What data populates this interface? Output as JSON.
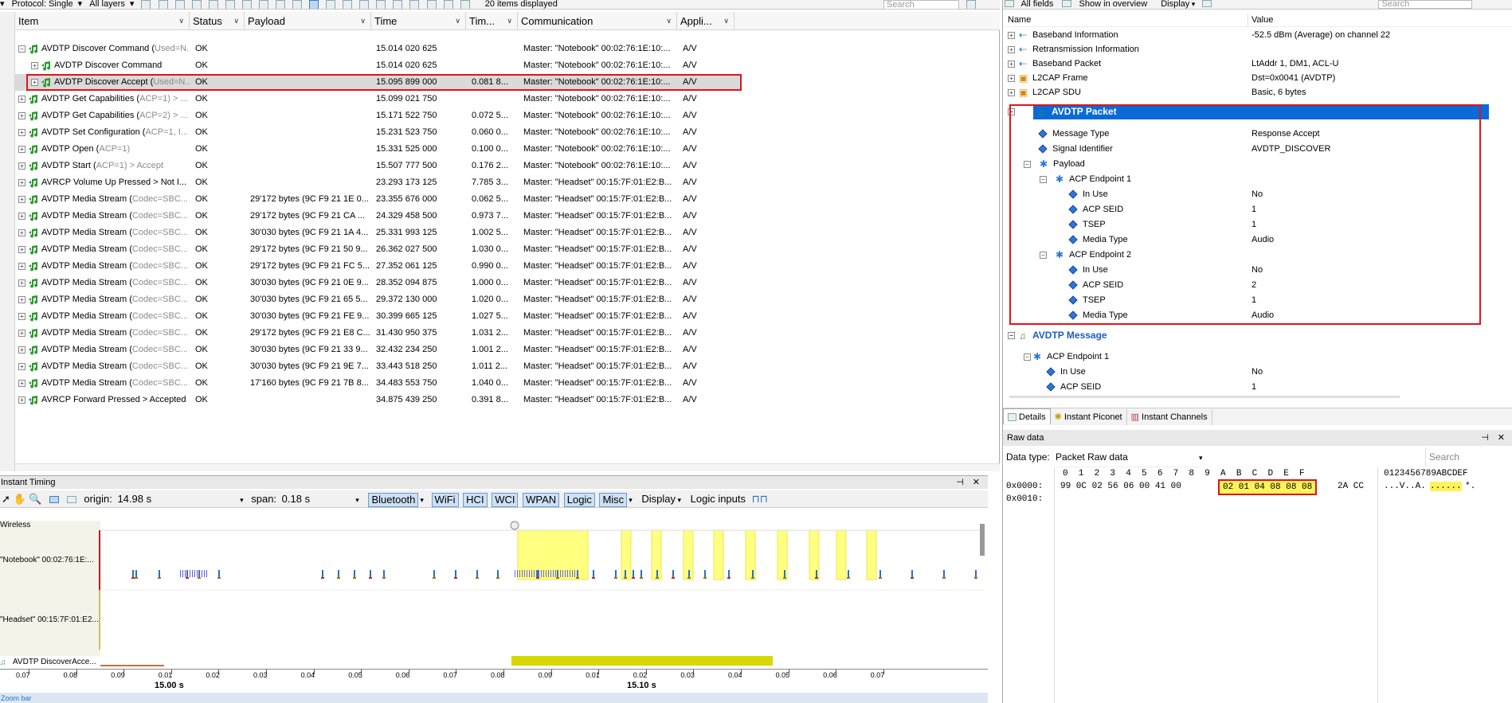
{
  "toolbar": {
    "protocol": "Protocol: Single",
    "layers": "All layers",
    "items_displayed": "20 items displayed",
    "search_placeholder": "Search"
  },
  "columns": [
    "Item",
    "Status",
    "Payload",
    "Time",
    "Tim...",
    "Communication",
    "Appli..."
  ],
  "rows": [
    {
      "exp": "−",
      "indent": 0,
      "item": "AVDTP Discover Command",
      "extra": "Used=N...",
      "status": "OK",
      "payload": "",
      "time": "15.014 020 625",
      "delta": "",
      "comm": "Master: \"Notebook\" 00:02:76:1E:10:...",
      "app": "A/V"
    },
    {
      "exp": "+",
      "indent": 1,
      "item": "AVDTP Discover Command",
      "extra": "",
      "status": "OK",
      "payload": "",
      "time": "15.014 020 625",
      "delta": "",
      "comm": "Master: \"Notebook\" 00:02:76:1E:10:...",
      "app": "A/V"
    },
    {
      "exp": "+",
      "indent": 1,
      "item": "AVDTP Discover Accept",
      "extra": "Used=N...",
      "status": "OK",
      "payload": "",
      "time": "15.095 899 000",
      "delta": "0.081 8...",
      "comm": "Master: \"Notebook\" 00:02:76:1E:10:...",
      "app": "A/V"
    },
    {
      "exp": "+",
      "indent": 0,
      "item": "AVDTP Get Capabilities",
      "extra": "ACP=1) > ...",
      "status": "OK",
      "payload": "",
      "time": "15.099 021 750",
      "delta": "",
      "comm": "Master: \"Notebook\" 00:02:76:1E:10:...",
      "app": "A/V"
    },
    {
      "exp": "+",
      "indent": 0,
      "item": "AVDTP Get Capabilities",
      "extra": "ACP=2) > ...",
      "status": "OK",
      "payload": "",
      "time": "15.171 522 750",
      "delta": "0.072 5...",
      "comm": "Master: \"Notebook\" 00:02:76:1E:10:...",
      "app": "A/V"
    },
    {
      "exp": "+",
      "indent": 0,
      "item": "AVDTP Set Configuration",
      "extra": "ACP=1, I...",
      "status": "OK",
      "payload": "",
      "time": "15.231 523 750",
      "delta": "0.060 0...",
      "comm": "Master: \"Notebook\" 00:02:76:1E:10:...",
      "app": "A/V"
    },
    {
      "exp": "+",
      "indent": 0,
      "item": "AVDTP Open",
      "extra": "ACP=1)",
      "status": "OK",
      "payload": "",
      "time": "15.331 525 000",
      "delta": "0.100 0...",
      "comm": "Master: \"Notebook\" 00:02:76:1E:10:...",
      "app": "A/V"
    },
    {
      "exp": "+",
      "indent": 0,
      "item": "AVDTP Start",
      "extra": "ACP=1) > Accept",
      "status": "OK",
      "payload": "",
      "time": "15.507 777 500",
      "delta": "0.176 2...",
      "comm": "Master: \"Notebook\" 00:02:76:1E:10:...",
      "app": "A/V"
    },
    {
      "exp": "+",
      "indent": 0,
      "item": "AVRCP Volume Up Pressed > Not I...",
      "extra": "",
      "status": "OK",
      "payload": "",
      "time": "23.293 173 125",
      "delta": "7.785 3...",
      "comm": "Master: \"Headset\" 00:15:7F:01:E2:B...",
      "app": "A/V"
    },
    {
      "exp": "+",
      "indent": 0,
      "item": "AVDTP Media Stream",
      "extra": "Codec=SBC...",
      "status": "OK",
      "payload": "29'172 bytes (9C F9 21 1E 0...",
      "time": "23.355 676 000",
      "delta": "0.062 5...",
      "comm": "Master: \"Headset\" 00:15:7F:01:E2:B...",
      "app": "A/V"
    },
    {
      "exp": "+",
      "indent": 0,
      "item": "AVDTP Media Stream",
      "extra": "Codec=SBC...",
      "status": "OK",
      "payload": "29'172 bytes (9C F9 21 CA ...",
      "time": "24.329 458 500",
      "delta": "0.973 7...",
      "comm": "Master: \"Headset\" 00:15:7F:01:E2:B...",
      "app": "A/V"
    },
    {
      "exp": "+",
      "indent": 0,
      "item": "AVDTP Media Stream",
      "extra": "Codec=SBC...",
      "status": "OK",
      "payload": "30'030 bytes (9C F9 21 1A 4...",
      "time": "25.331 993 125",
      "delta": "1.002 5...",
      "comm": "Master: \"Headset\" 00:15:7F:01:E2:B...",
      "app": "A/V"
    },
    {
      "exp": "+",
      "indent": 0,
      "item": "AVDTP Media Stream",
      "extra": "Codec=SBC...",
      "status": "OK",
      "payload": "29'172 bytes (9C F9 21 50 9...",
      "time": "26.362 027 500",
      "delta": "1.030 0...",
      "comm": "Master: \"Headset\" 00:15:7F:01:E2:B...",
      "app": "A/V"
    },
    {
      "exp": "+",
      "indent": 0,
      "item": "AVDTP Media Stream",
      "extra": "Codec=SBC...",
      "status": "OK",
      "payload": "29'172 bytes (9C F9 21 FC 5...",
      "time": "27.352 061 125",
      "delta": "0.990 0...",
      "comm": "Master: \"Headset\" 00:15:7F:01:E2:B...",
      "app": "A/V"
    },
    {
      "exp": "+",
      "indent": 0,
      "item": "AVDTP Media Stream",
      "extra": "Codec=SBC...",
      "status": "OK",
      "payload": "30'030 bytes (9C F9 21 0E 9...",
      "time": "28.352 094 875",
      "delta": "1.000 0...",
      "comm": "Master: \"Headset\" 00:15:7F:01:E2:B...",
      "app": "A/V"
    },
    {
      "exp": "+",
      "indent": 0,
      "item": "AVDTP Media Stream",
      "extra": "Codec=SBC...",
      "status": "OK",
      "payload": "30'030 bytes (9C F9 21 65 5...",
      "time": "29.372 130 000",
      "delta": "1.020 0...",
      "comm": "Master: \"Headset\" 00:15:7F:01:E2:B...",
      "app": "A/V"
    },
    {
      "exp": "+",
      "indent": 0,
      "item": "AVDTP Media Stream",
      "extra": "Codec=SBC...",
      "status": "OK",
      "payload": "30'030 bytes (9C F9 21 FE 9...",
      "time": "30.399 665 125",
      "delta": "1.027 5...",
      "comm": "Master: \"Headset\" 00:15:7F:01:E2:B...",
      "app": "A/V"
    },
    {
      "exp": "+",
      "indent": 0,
      "item": "AVDTP Media Stream",
      "extra": "Codec=SBC...",
      "status": "OK",
      "payload": "29'172 bytes (9C F9 21 E8 C...",
      "time": "31.430 950 375",
      "delta": "1.031 2...",
      "comm": "Master: \"Headset\" 00:15:7F:01:E2:B...",
      "app": "A/V"
    },
    {
      "exp": "+",
      "indent": 0,
      "item": "AVDTP Media Stream",
      "extra": "Codec=SBC...",
      "status": "OK",
      "payload": "30'030 bytes (9C F9 21 33 9...",
      "time": "32.432 234 250",
      "delta": "1.001 2...",
      "comm": "Master: \"Headset\" 00:15:7F:01:E2:B...",
      "app": "A/V"
    },
    {
      "exp": "+",
      "indent": 0,
      "item": "AVDTP Media Stream",
      "extra": "Codec=SBC...",
      "status": "OK",
      "payload": "30'030 bytes (9C F9 21 9E 7...",
      "time": "33.443 518 250",
      "delta": "1.011 2...",
      "comm": "Master: \"Headset\" 00:15:7F:01:E2:B...",
      "app": "A/V"
    },
    {
      "exp": "+",
      "indent": 0,
      "item": "AVDTP Media Stream",
      "extra": "Codec=SBC...",
      "status": "OK",
      "payload": "17'160 bytes (9C F9 21 7B 8...",
      "time": "34.483 553 750",
      "delta": "1.040 0...",
      "comm": "Master: \"Headset\" 00:15:7F:01:E2:B...",
      "app": "A/V"
    },
    {
      "exp": "+",
      "indent": 0,
      "item": "AVRCP Forward Pressed > Accepted",
      "extra": "",
      "status": "OK",
      "payload": "",
      "time": "34.875 439 250",
      "delta": "0.391 8...",
      "comm": "Master: \"Headset\" 00:15:7F:01:E2:B...",
      "app": "A/V"
    }
  ],
  "timing": {
    "title": "Instant Timing",
    "origin_label": "origin:",
    "origin_value": "14.98 s",
    "span_label": "span:",
    "span_value": "0.18 s",
    "filters": [
      "Bluetooth",
      "WiFi",
      "HCI",
      "WCI",
      "WPAN",
      "Logic",
      "Misc"
    ],
    "display_label": "Display",
    "logic_label": "Logic inputs",
    "lanes": {
      "wireless": "Wireless",
      "notebook": "\"Notebook\" 00:02:76:1E:...",
      "headset": "\"Headset\" 00:15:7F:01:E2...",
      "avdtp": "AVDTP DiscoverAcce..."
    },
    "ruler_ticks": [
      "0.07",
      "0.08",
      "0.09",
      "0.01",
      "0.02",
      "0.03",
      "0.04",
      "0.05",
      "0.06",
      "0.07",
      "0.08",
      "0.09",
      "0.01",
      "0.02",
      "0.03",
      "0.04",
      "0.05",
      "0.06",
      "0.07"
    ],
    "ruler_major_1": "15.00  s",
    "ruler_major_2": "15.10  s",
    "zoom_label": "Zoom bar"
  },
  "right": {
    "top_buttons": {
      "all_fields": "All fields",
      "show_overview": "Show in overview",
      "display": "Display",
      "search": "Search"
    },
    "header_name": "Name",
    "header_value": "Value",
    "fields": [
      {
        "name": "Baseband Information",
        "value": "-52.5 dBm (Average) on channel 22"
      },
      {
        "name": "Retransmission Information",
        "value": ""
      },
      {
        "name": "Baseband Packet",
        "value": "LtAddr 1, DM1, ACL-U"
      },
      {
        "name": "L2CAP Frame",
        "value": "Dst=0x0041 (AVDTP)"
      },
      {
        "name": "L2CAP SDU",
        "value": "Basic, 6 bytes"
      }
    ],
    "avdtp_packet": "AVDTP Packet",
    "packet_fields": [
      {
        "name": "Message Type",
        "value": "Response Accept"
      },
      {
        "name": "Signal Identifier",
        "value": "AVDTP_DISCOVER"
      }
    ],
    "payload": "Payload",
    "ep1": "ACP Endpoint 1",
    "ep1_fields": [
      {
        "name": "In Use",
        "value": "No"
      },
      {
        "name": "ACP SEID",
        "value": "1"
      },
      {
        "name": "TSEP",
        "value": "1"
      },
      {
        "name": "Media Type",
        "value": "Audio"
      }
    ],
    "ep2": "ACP Endpoint 2",
    "ep2_fields": [
      {
        "name": "In Use",
        "value": "No"
      },
      {
        "name": "ACP SEID",
        "value": "2"
      },
      {
        "name": "TSEP",
        "value": "1"
      },
      {
        "name": "Media Type",
        "value": "Audio"
      }
    ],
    "avdtp_message": "AVDTP Message",
    "msg_ep1": "ACP Endpoint 1",
    "msg_fields": [
      {
        "name": "In Use",
        "value": "No"
      },
      {
        "name": "ACP SEID",
        "value": "1"
      }
    ],
    "tabs": [
      "Details",
      "Instant Piconet",
      "Instant Channels"
    ],
    "raw_title": "Raw data",
    "data_type_label": "Data type:",
    "data_type_value": "Packet Raw data",
    "raw_search": "Search",
    "hex_header": "0  1  2  3  4  5  6  7  8  9  A  B  C  D  E  F",
    "ascii_header": "0123456789ABCDEF",
    "hex_line1_addr": "0x0000:",
    "hex_line1_a": "99 0C 02 56 06 00 41 00",
    "hex_line1_b": "02 01 04 08 08 08",
    "hex_line1_c": "2A CC",
    "ascii_line1_a": "...V..A.",
    "ascii_line1_b": "......",
    "ascii_line1_c": "*.",
    "hex_line2_addr": "0x0010:"
  }
}
